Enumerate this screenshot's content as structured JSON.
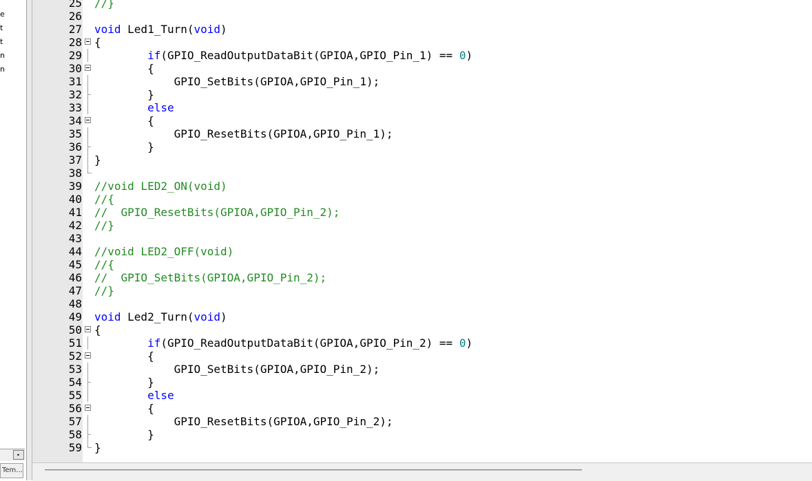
{
  "left_panel": {
    "letters": [
      "e",
      "t",
      "t",
      "n",
      "n"
    ],
    "tab_label": "Tem...",
    "scroll_arrow": "▸"
  },
  "editor": {
    "lines": [
      {
        "n": "25",
        "fold": "none",
        "tokens": [
          {
            "t": "//}",
            "c": "cm"
          }
        ]
      },
      {
        "n": "26",
        "fold": "none",
        "tokens": []
      },
      {
        "n": "27",
        "fold": "none",
        "tokens": [
          {
            "t": "void",
            "c": "kw"
          },
          {
            "t": " Led1_Turn(",
            "c": "pl"
          },
          {
            "t": "void",
            "c": "kw"
          },
          {
            "t": ")",
            "c": "pl"
          }
        ]
      },
      {
        "n": "28",
        "fold": "open",
        "tokens": [
          {
            "t": "{",
            "c": "pl"
          }
        ]
      },
      {
        "n": "29",
        "fold": "line",
        "tokens": [
          {
            "t": "        ",
            "c": "pl"
          },
          {
            "t": "if",
            "c": "kw"
          },
          {
            "t": "(GPIO_ReadOutputDataBit(GPIOA,GPIO_Pin_1) == ",
            "c": "pl"
          },
          {
            "t": "0",
            "c": "nm"
          },
          {
            "t": ")",
            "c": "pl"
          }
        ]
      },
      {
        "n": "30",
        "fold": "open",
        "tokens": [
          {
            "t": "        {",
            "c": "pl"
          }
        ]
      },
      {
        "n": "31",
        "fold": "line",
        "tokens": [
          {
            "t": "            GPIO_SetBits(GPIOA,GPIO_Pin_1);",
            "c": "pl"
          }
        ]
      },
      {
        "n": "32",
        "fold": "tick",
        "tokens": [
          {
            "t": "        }",
            "c": "pl"
          }
        ]
      },
      {
        "n": "33",
        "fold": "line",
        "tokens": [
          {
            "t": "        ",
            "c": "pl"
          },
          {
            "t": "else",
            "c": "kw"
          }
        ]
      },
      {
        "n": "34",
        "fold": "open",
        "tokens": [
          {
            "t": "        {",
            "c": "pl"
          }
        ]
      },
      {
        "n": "35",
        "fold": "line",
        "tokens": [
          {
            "t": "            GPIO_ResetBits(GPIOA,GPIO_Pin_1);",
            "c": "pl"
          }
        ]
      },
      {
        "n": "36",
        "fold": "tick",
        "tokens": [
          {
            "t": "        }",
            "c": "pl"
          }
        ]
      },
      {
        "n": "37",
        "fold": "line",
        "tokens": [
          {
            "t": "}",
            "c": "pl"
          }
        ]
      },
      {
        "n": "38",
        "fold": "end",
        "tokens": []
      },
      {
        "n": "39",
        "fold": "none",
        "tokens": [
          {
            "t": "//void LED2_ON(void)",
            "c": "cm"
          }
        ]
      },
      {
        "n": "40",
        "fold": "none",
        "tokens": [
          {
            "t": "//{",
            "c": "cm"
          }
        ]
      },
      {
        "n": "41",
        "fold": "none",
        "tokens": [
          {
            "t": "//  GPIO_ResetBits(GPIOA,GPIO_Pin_2);",
            "c": "cm"
          }
        ]
      },
      {
        "n": "42",
        "fold": "none",
        "tokens": [
          {
            "t": "//}",
            "c": "cm"
          }
        ]
      },
      {
        "n": "43",
        "fold": "none",
        "tokens": []
      },
      {
        "n": "44",
        "fold": "none",
        "tokens": [
          {
            "t": "//void LED2_OFF(void)",
            "c": "cm"
          }
        ]
      },
      {
        "n": "45",
        "fold": "none",
        "tokens": [
          {
            "t": "//{",
            "c": "cm"
          }
        ]
      },
      {
        "n": "46",
        "fold": "none",
        "tokens": [
          {
            "t": "//  GPIO_SetBits(GPIOA,GPIO_Pin_2);",
            "c": "cm"
          }
        ]
      },
      {
        "n": "47",
        "fold": "none",
        "tokens": [
          {
            "t": "//}",
            "c": "cm"
          }
        ]
      },
      {
        "n": "48",
        "fold": "none",
        "tokens": []
      },
      {
        "n": "49",
        "fold": "none",
        "tokens": [
          {
            "t": "void",
            "c": "kw"
          },
          {
            "t": " Led2_Turn(",
            "c": "pl"
          },
          {
            "t": "void",
            "c": "kw"
          },
          {
            "t": ")",
            "c": "pl"
          }
        ]
      },
      {
        "n": "50",
        "fold": "open",
        "tokens": [
          {
            "t": "{",
            "c": "pl"
          }
        ]
      },
      {
        "n": "51",
        "fold": "line",
        "tokens": [
          {
            "t": "        ",
            "c": "pl"
          },
          {
            "t": "if",
            "c": "kw"
          },
          {
            "t": "(GPIO_ReadOutputDataBit(GPIOA,GPIO_Pin_2) == ",
            "c": "pl"
          },
          {
            "t": "0",
            "c": "nm"
          },
          {
            "t": ")",
            "c": "pl"
          }
        ]
      },
      {
        "n": "52",
        "fold": "open",
        "tokens": [
          {
            "t": "        {",
            "c": "pl"
          }
        ]
      },
      {
        "n": "53",
        "fold": "line",
        "tokens": [
          {
            "t": "            GPIO_SetBits(GPIOA,GPIO_Pin_2);",
            "c": "pl"
          }
        ]
      },
      {
        "n": "54",
        "fold": "tick",
        "tokens": [
          {
            "t": "        }",
            "c": "pl"
          }
        ]
      },
      {
        "n": "55",
        "fold": "line",
        "tokens": [
          {
            "t": "        ",
            "c": "pl"
          },
          {
            "t": "else",
            "c": "kw"
          }
        ]
      },
      {
        "n": "56",
        "fold": "open",
        "tokens": [
          {
            "t": "        {",
            "c": "pl"
          }
        ]
      },
      {
        "n": "57",
        "fold": "line",
        "tokens": [
          {
            "t": "            GPIO_ResetBits(GPIOA,GPIO_Pin_2);",
            "c": "pl"
          }
        ]
      },
      {
        "n": "58",
        "fold": "tick",
        "tokens": [
          {
            "t": "        }",
            "c": "pl"
          }
        ]
      },
      {
        "n": "59",
        "fold": "end",
        "tokens": [
          {
            "t": "}",
            "c": "pl"
          }
        ]
      }
    ]
  },
  "colors": {
    "keyword": "#0000ff",
    "comment": "#228b22",
    "number": "#008080",
    "gutter": "#e8e8e8"
  }
}
